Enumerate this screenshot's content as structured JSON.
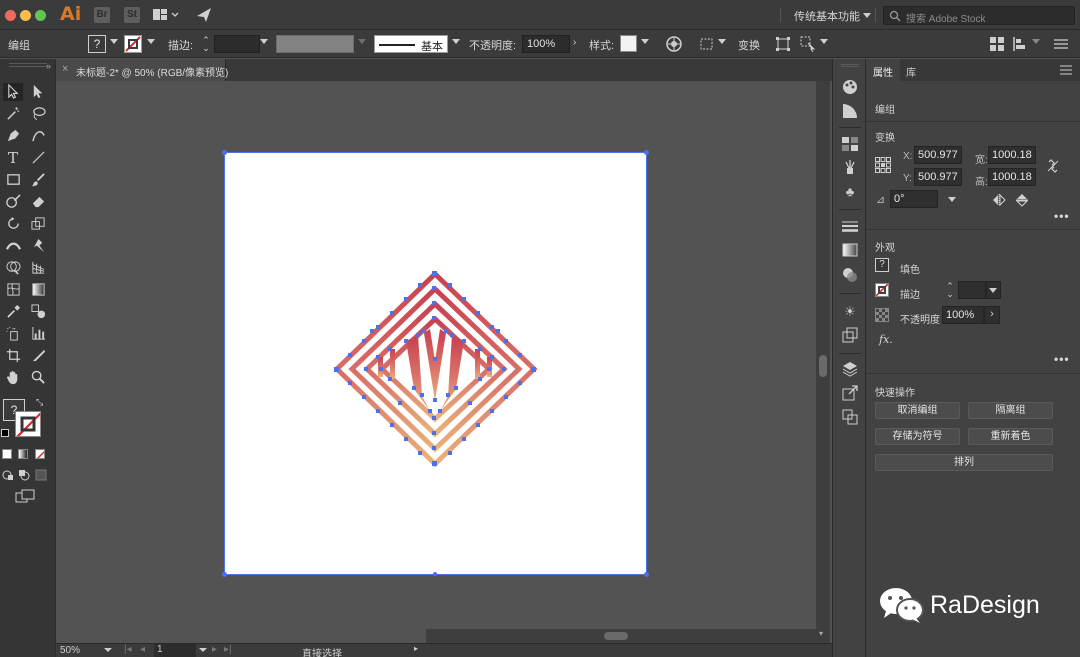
{
  "app": {
    "logo": "Ai",
    "bridge_label": "Br",
    "stock_label": "St",
    "workspace": "传统基本功能",
    "search_placeholder": "搜索 Adobe Stock"
  },
  "control_bar": {
    "selection_type": "编组",
    "stroke_label": "描边:",
    "stroke_profile": "基本",
    "opacity_label": "不透明度:",
    "opacity_value": "100%",
    "style_label": "样式:",
    "transform_label": "变换"
  },
  "document_tab": {
    "title": "未标题-2* @ 50% (RGB/像素预览)"
  },
  "status_bar": {
    "zoom": "50%",
    "page": "1",
    "tool_name": "直接选择"
  },
  "properties_panel": {
    "tabs": [
      "属性",
      "库"
    ],
    "object_type": "编组",
    "transform": {
      "title": "变换",
      "x_label": "X:",
      "x_value": "500.977",
      "y_label": "Y:",
      "y_value": "500.977",
      "w_label": "宽:",
      "w_value": "1000.18",
      "h_label": "高:",
      "h_value": "1000.18",
      "angle_value": "0°"
    },
    "appearance": {
      "title": "外观",
      "fill_label": "填色",
      "stroke_label": "描边",
      "opacity_label": "不透明度",
      "opacity_value": "100%",
      "fx_label": "fx."
    },
    "quick_actions": {
      "title": "快速操作",
      "ungroup": "取消编组",
      "isolate": "隔离组",
      "save_symbol": "存储为符号",
      "recolor": "重新着色",
      "arrange": "排列"
    }
  },
  "watermark": {
    "text": "RaDesign"
  },
  "colors": {
    "artwork_red": "#c94b5a",
    "artwork_orange": "#e8a06a",
    "anchor_blue": "#4b72e8",
    "ai_orange": "#d87a2e"
  }
}
